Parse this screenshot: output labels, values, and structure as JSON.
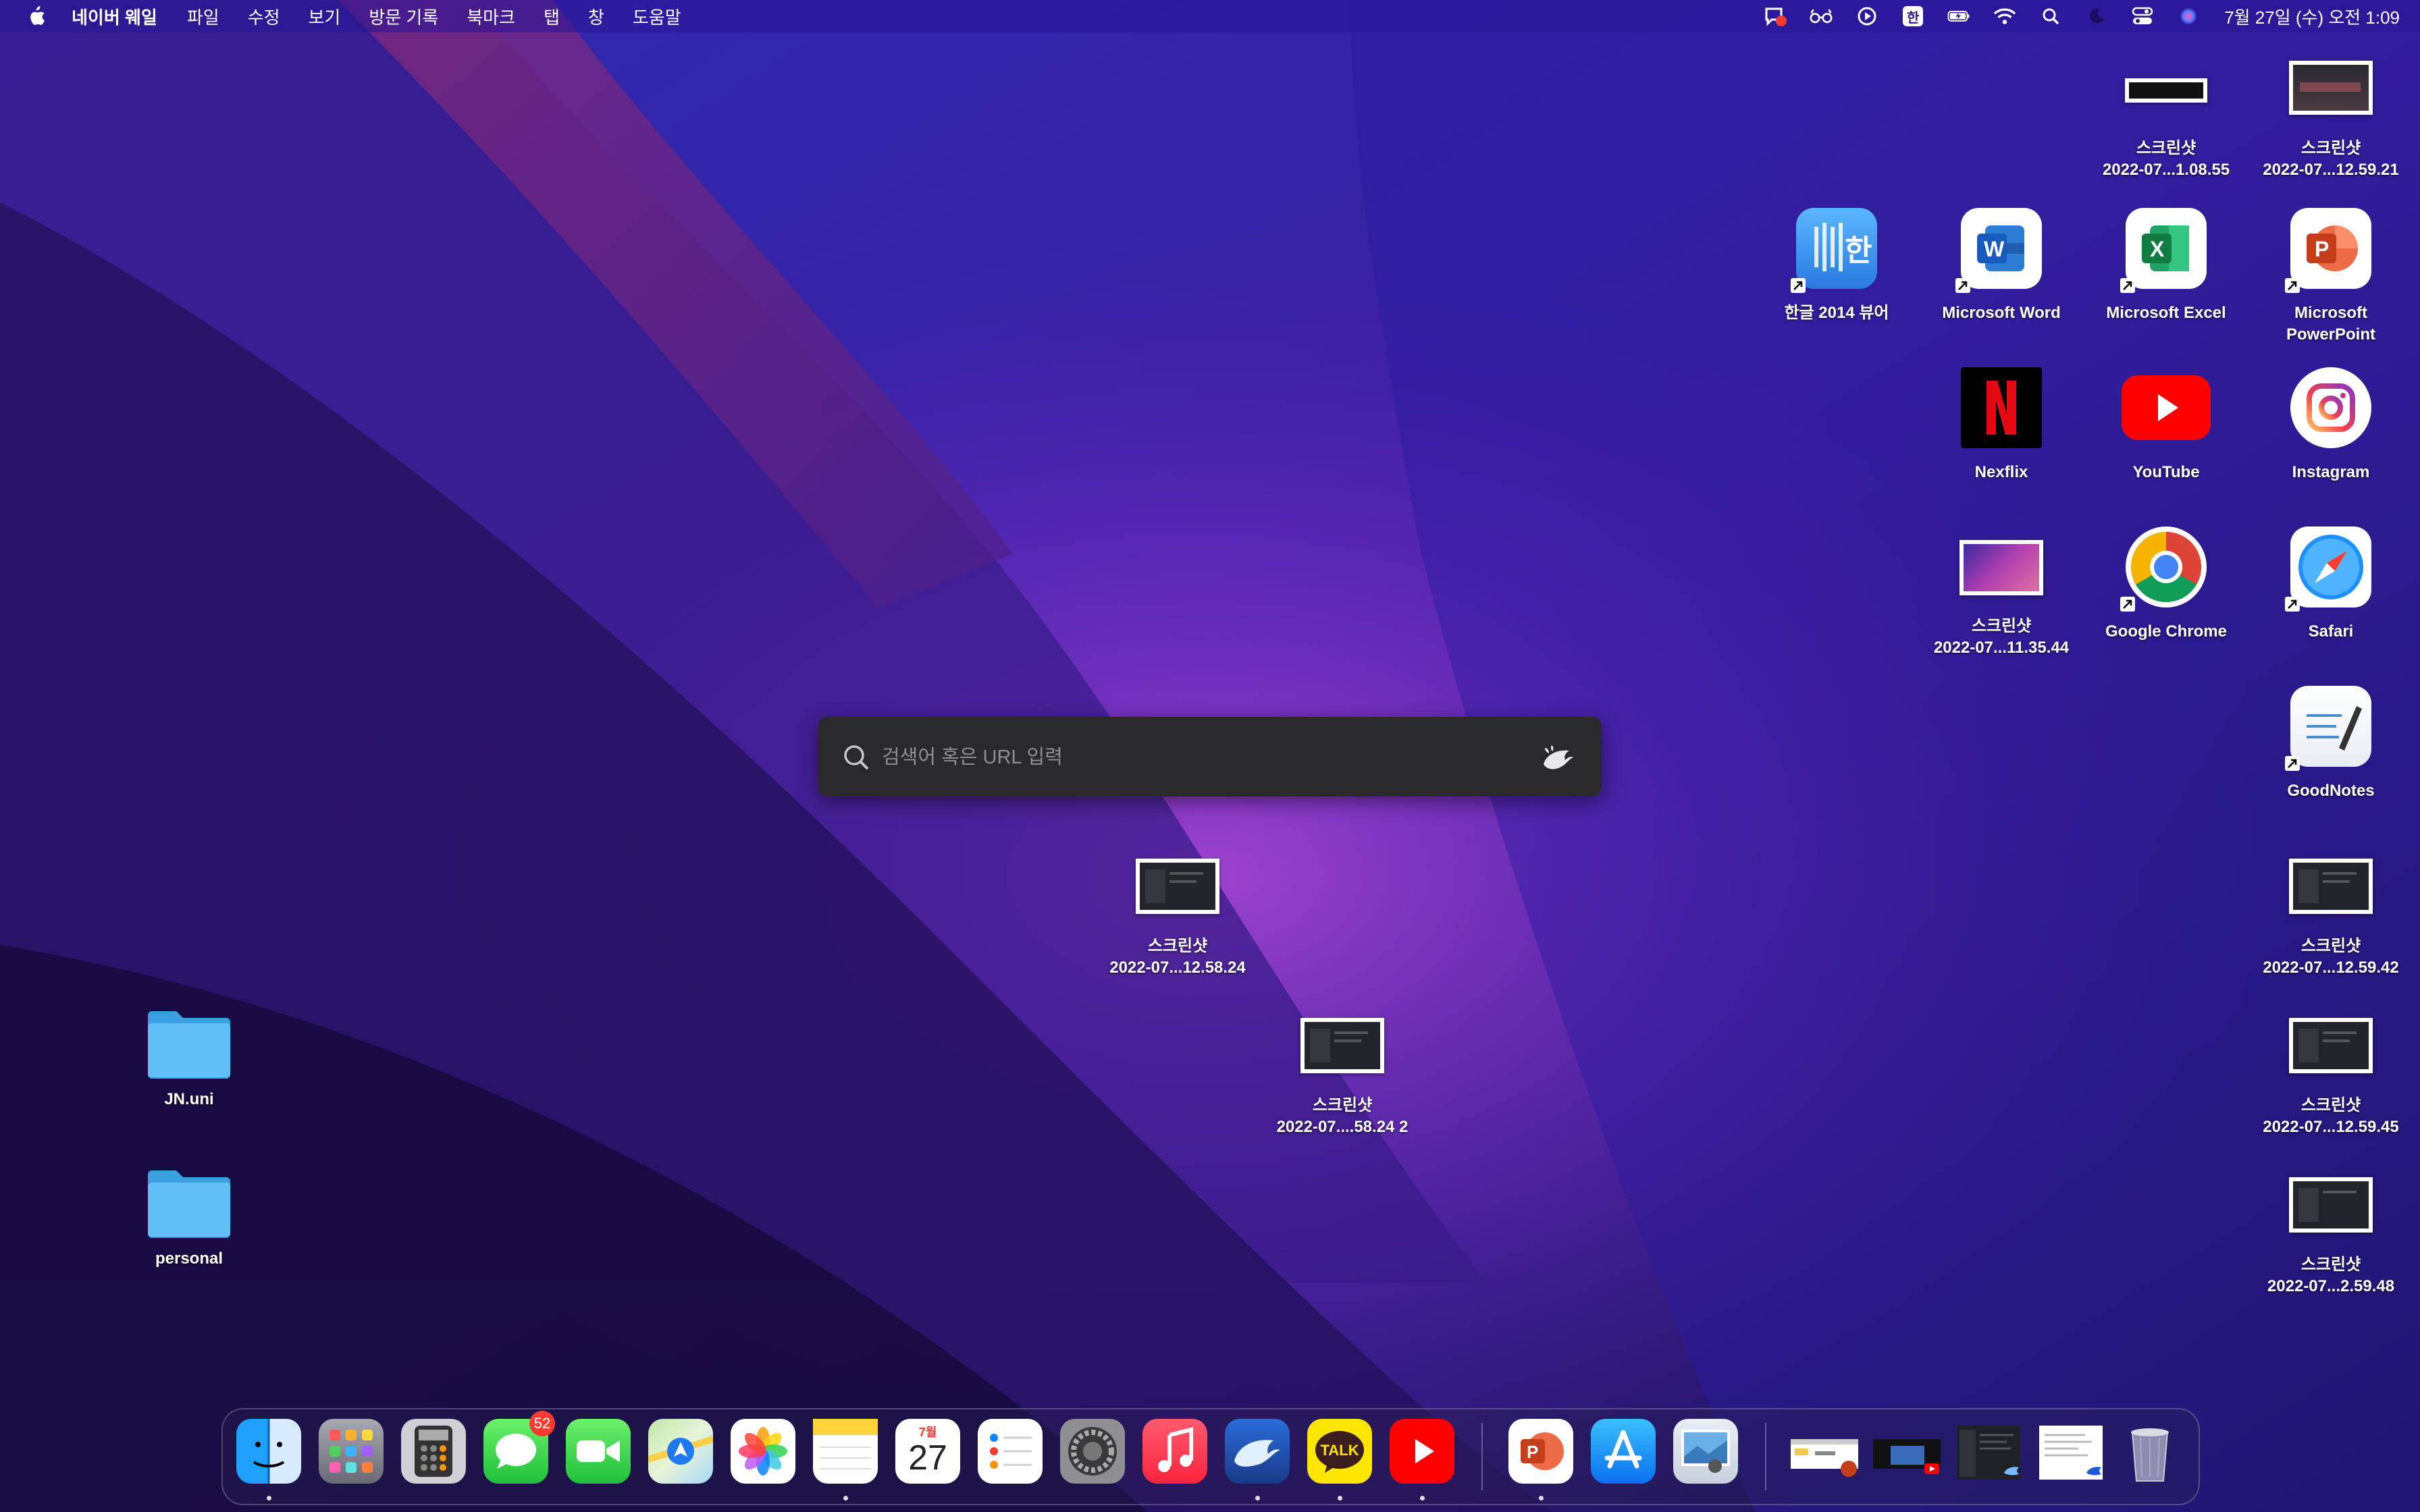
{
  "menubar": {
    "app_name": "네이버 웨일",
    "items": [
      "파일",
      "수정",
      "보기",
      "방문 기록",
      "북마크",
      "탭",
      "창",
      "도움말"
    ],
    "status_icons": [
      "notification-badge-icon",
      "reader-glasses-icon",
      "play-circle-icon",
      "input-method-icon",
      "battery-icon",
      "wifi-icon",
      "spotlight-search-icon",
      "focus-moon-icon",
      "control-center-icon",
      "siri-icon"
    ],
    "input_method_label": "한",
    "clock": "7월 27일 (수) 오전 1:09"
  },
  "desktop": {
    "screenshots_top": [
      {
        "label1": "스크린샷",
        "label2": "2022-07...1.08.55"
      },
      {
        "label1": "스크린샷",
        "label2": "2022-07...12.59.21"
      }
    ],
    "apps_row1": [
      {
        "label": "한글 2014 뷰어",
        "icon": "hangul-viewer-icon"
      },
      {
        "label": "Microsoft Word",
        "icon": "word-icon"
      },
      {
        "label": "Microsoft Excel",
        "icon": "excel-icon"
      },
      {
        "label1": "Microsoft",
        "label2": "PowerPoint",
        "icon": "powerpoint-icon"
      }
    ],
    "apps_row2": [
      {
        "label": "Nexflix",
        "icon": "netflix-icon"
      },
      {
        "label": "YouTube",
        "icon": "youtube-icon"
      },
      {
        "label": "Instagram",
        "icon": "instagram-icon"
      }
    ],
    "apps_row3": [
      {
        "label1": "스크린샷",
        "label2": "2022-07...11.35.44"
      },
      {
        "label": "Google Chrome",
        "icon": "chrome-icon"
      },
      {
        "label": "Safari",
        "icon": "safari-icon"
      }
    ],
    "goodnotes": {
      "label": "GoodNotes"
    },
    "screenshots_right": [
      {
        "label1": "스크린샷",
        "label2": "2022-07...12.59.42"
      },
      {
        "label1": "스크린샷",
        "label2": "2022-07...12.59.45"
      },
      {
        "label1": "스크린샷",
        "label2": "2022-07...2.59.48"
      }
    ],
    "screenshots_center": [
      {
        "label1": "스크린샷",
        "label2": "2022-07...12.58.24"
      },
      {
        "label1": "스크린샷",
        "label2": "2022-07....58.24 2"
      }
    ],
    "folders": [
      {
        "label": "JN.uni"
      },
      {
        "label": "personal"
      }
    ]
  },
  "search": {
    "placeholder": "검색어 혹은 URL 입력",
    "value": ""
  },
  "dock": {
    "apps": [
      "finder-icon",
      "launchpad-icon",
      "calculator-icon",
      "messages-icon",
      "facetime-icon",
      "maps-icon",
      "photos-icon",
      "notes-icon",
      "calendar-icon",
      "reminders-icon",
      "system-preferences-icon",
      "music-icon",
      "whale-browser-icon",
      "kakaotalk-icon",
      "youtube-icon",
      "powerpoint-icon",
      "app-store-icon",
      "preview-icon",
      "recent-window-1",
      "recent-window-2",
      "recent-window-3",
      "recent-window-4",
      "trash-icon"
    ],
    "messages_badge": "52",
    "calendar_month": "7월",
    "calendar_day": "27",
    "kakao_label": "TALK"
  },
  "colors": {
    "menubar": "#2a1496",
    "search_bg": "#2a2a2c",
    "accent_red": "#ff3b30"
  }
}
